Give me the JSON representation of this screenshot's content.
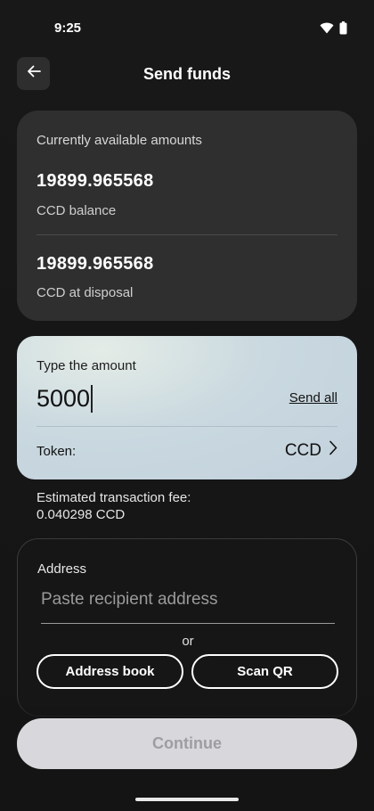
{
  "status_bar": {
    "time": "9:25",
    "icons": [
      "wifi-icon",
      "battery-icon"
    ]
  },
  "header": {
    "back_icon": "arrow-left-icon",
    "title": "Send funds"
  },
  "balance_card": {
    "heading": "Currently available amounts",
    "balance_value": "19899.965568",
    "balance_label": "CCD balance",
    "disposal_value": "19899.965568",
    "disposal_label": "CCD at disposal"
  },
  "amount_card": {
    "heading": "Type the amount",
    "amount_value": "5000",
    "send_all_label": "Send all",
    "token_label": "Token:",
    "token_value": "CCD",
    "token_icon": "chevron-right-icon"
  },
  "fee": {
    "label": "Estimated transaction fee:",
    "value": "0.040298 CCD"
  },
  "address_card": {
    "heading": "Address",
    "placeholder": "Paste recipient address",
    "or_text": "or",
    "address_book_label": "Address book",
    "scan_qr_label": "Scan QR"
  },
  "footer": {
    "continue_label": "Continue"
  },
  "colors": {
    "background": "#141414",
    "card_dark": "#2f2f2f",
    "amount_card": "#c8d7df",
    "continue_disabled": "#d8d8dc"
  }
}
